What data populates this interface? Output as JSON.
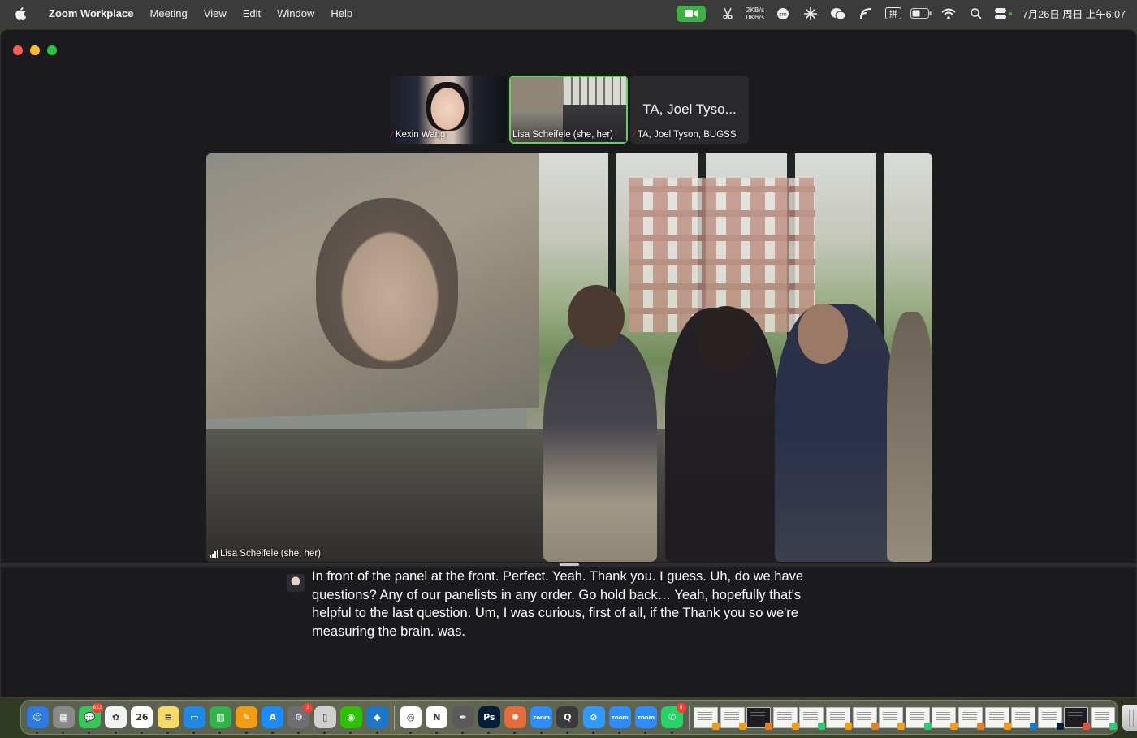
{
  "menubar": {
    "app_name": "Zoom Workplace",
    "menus": [
      "Meeting",
      "View",
      "Edit",
      "Window",
      "Help"
    ],
    "net_up": "2KB/s",
    "net_down": "0KB/s",
    "status_box_label": "拼",
    "clock": "7月26日 周日 上午6:07",
    "icons": [
      "zoom-video-icon",
      "scissors-icon",
      "zm-icon",
      "sparkle-icon",
      "wechat-icon",
      "signal-icon",
      "input-method-icon",
      "battery-icon",
      "wifi-icon",
      "search-icon",
      "control-center-icon"
    ]
  },
  "meeting": {
    "thumbnails": [
      {
        "name": "Kexin Wang",
        "muted": true
      },
      {
        "name": "Lisa Scheifele (she, her)",
        "muted": false,
        "active": true
      },
      {
        "name": "TA, Joel Tyson, BUGSS",
        "display_title": "TA, Joel Tyso...",
        "muted": true
      }
    ],
    "main_speaker": "Lisa Scheifele (she, her)",
    "caption": "In front of the panel at the front. Perfect. Yeah. Thank you. I guess. Uh, do we have questions? Any of our panelists in any order. Go hold back… Yeah, hopefully that's helpful to the last question. Um, I was curious, first of all, if the Thank you so we're measuring the brain. was."
  },
  "dock": {
    "apps": [
      {
        "name": "finder-icon",
        "color": "#2c7be5",
        "glyph": "☺"
      },
      {
        "name": "launchpad-icon",
        "color": "#8a8a8a",
        "glyph": "▦"
      },
      {
        "name": "messages-icon",
        "color": "#34c759",
        "glyph": "💬",
        "badge": "612"
      },
      {
        "name": "photos-icon",
        "color": "#f2f2f2",
        "glyph": "✿"
      },
      {
        "name": "calendar-icon",
        "color": "#ffffff",
        "glyph": "26"
      },
      {
        "name": "notes-icon",
        "color": "#f5d96b",
        "glyph": "≡"
      },
      {
        "name": "keynote-icon",
        "color": "#1e88e5",
        "glyph": "▭"
      },
      {
        "name": "numbers-icon",
        "color": "#30b34a",
        "glyph": "▥"
      },
      {
        "name": "pages-icon",
        "color": "#f39c12",
        "glyph": "✎"
      },
      {
        "name": "app-store-icon",
        "color": "#1a8cff",
        "glyph": "A"
      },
      {
        "name": "system-settings-icon",
        "color": "#6e6e73",
        "glyph": "⚙",
        "badge": "1"
      },
      {
        "name": "preview-icon",
        "color": "#d0d0d0",
        "glyph": "▯"
      },
      {
        "name": "wechat-dock-icon",
        "color": "#2dc100",
        "glyph": "◉"
      },
      {
        "name": "vscode-icon",
        "color": "#1b78c9",
        "glyph": "◆"
      },
      {
        "name": "chrome-icon",
        "color": "#ffffff",
        "glyph": "◎"
      },
      {
        "name": "notion-like-icon",
        "color": "#ffffff",
        "glyph": "N"
      },
      {
        "name": "pen-icon",
        "color": "#5a5a5a",
        "glyph": "✒"
      },
      {
        "name": "photoshop-icon",
        "color": "#001e36",
        "glyph": "Ps"
      },
      {
        "name": "claude-icon",
        "color": "#e56b3a",
        "glyph": "✺"
      },
      {
        "name": "zoom-dock-icon",
        "color": "#2d8cff",
        "glyph": "zoom"
      },
      {
        "name": "quicktime-icon",
        "color": "#3a3a3c",
        "glyph": "Q"
      },
      {
        "name": "safari-icon",
        "color": "#2f9bff",
        "glyph": "⊘"
      },
      {
        "name": "zoom-dock-icon-2",
        "color": "#2d8cff",
        "glyph": "zoom"
      },
      {
        "name": "zoom-dock-icon-3",
        "color": "#2d8cff",
        "glyph": "zoom"
      },
      {
        "name": "whatsapp-icon",
        "color": "#25d366",
        "glyph": "✆",
        "badge": "8"
      }
    ],
    "docs_count_label": "",
    "trash_label": ""
  }
}
